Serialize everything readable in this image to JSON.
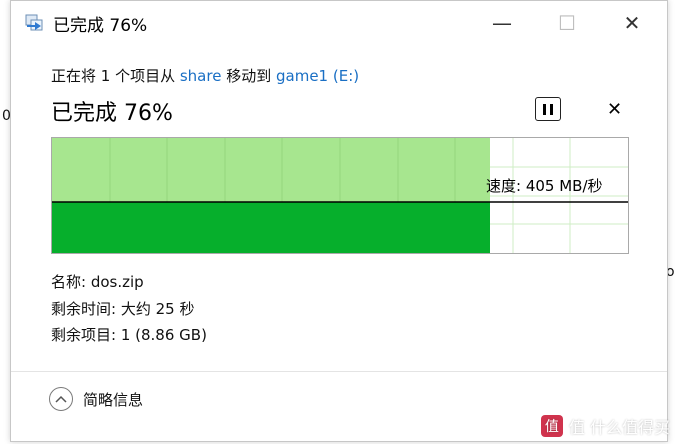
{
  "window": {
    "title": "已完成 76%",
    "controls": {
      "minimize": "—",
      "maximize": "☐",
      "close": "✕"
    }
  },
  "transfer": {
    "prefix": "正在将 1 个项目从 ",
    "source": "share",
    "middle": " 移动到 ",
    "destination": "game1 (E:)",
    "percent_label": "已完成 76%",
    "progress": 0.76,
    "speed_label": "速度: 405 MB/秒"
  },
  "details": {
    "name": "名称: dos.zip",
    "time_remaining": "剩余时间: 大约 25 秒",
    "items_remaining": "剩余项目: 1 (8.86 GB)"
  },
  "footer": {
    "toggle_label": "简略信息"
  },
  "colors": {
    "graph_fill": "#a7e68f",
    "graph_solid": "#06af2c",
    "graph_grid": "#cfeec4",
    "link": "#1a6fc4"
  },
  "background": {
    "left_glyph": "0",
    "right_glyph": "o",
    "watermark": "值 什么值得买"
  }
}
